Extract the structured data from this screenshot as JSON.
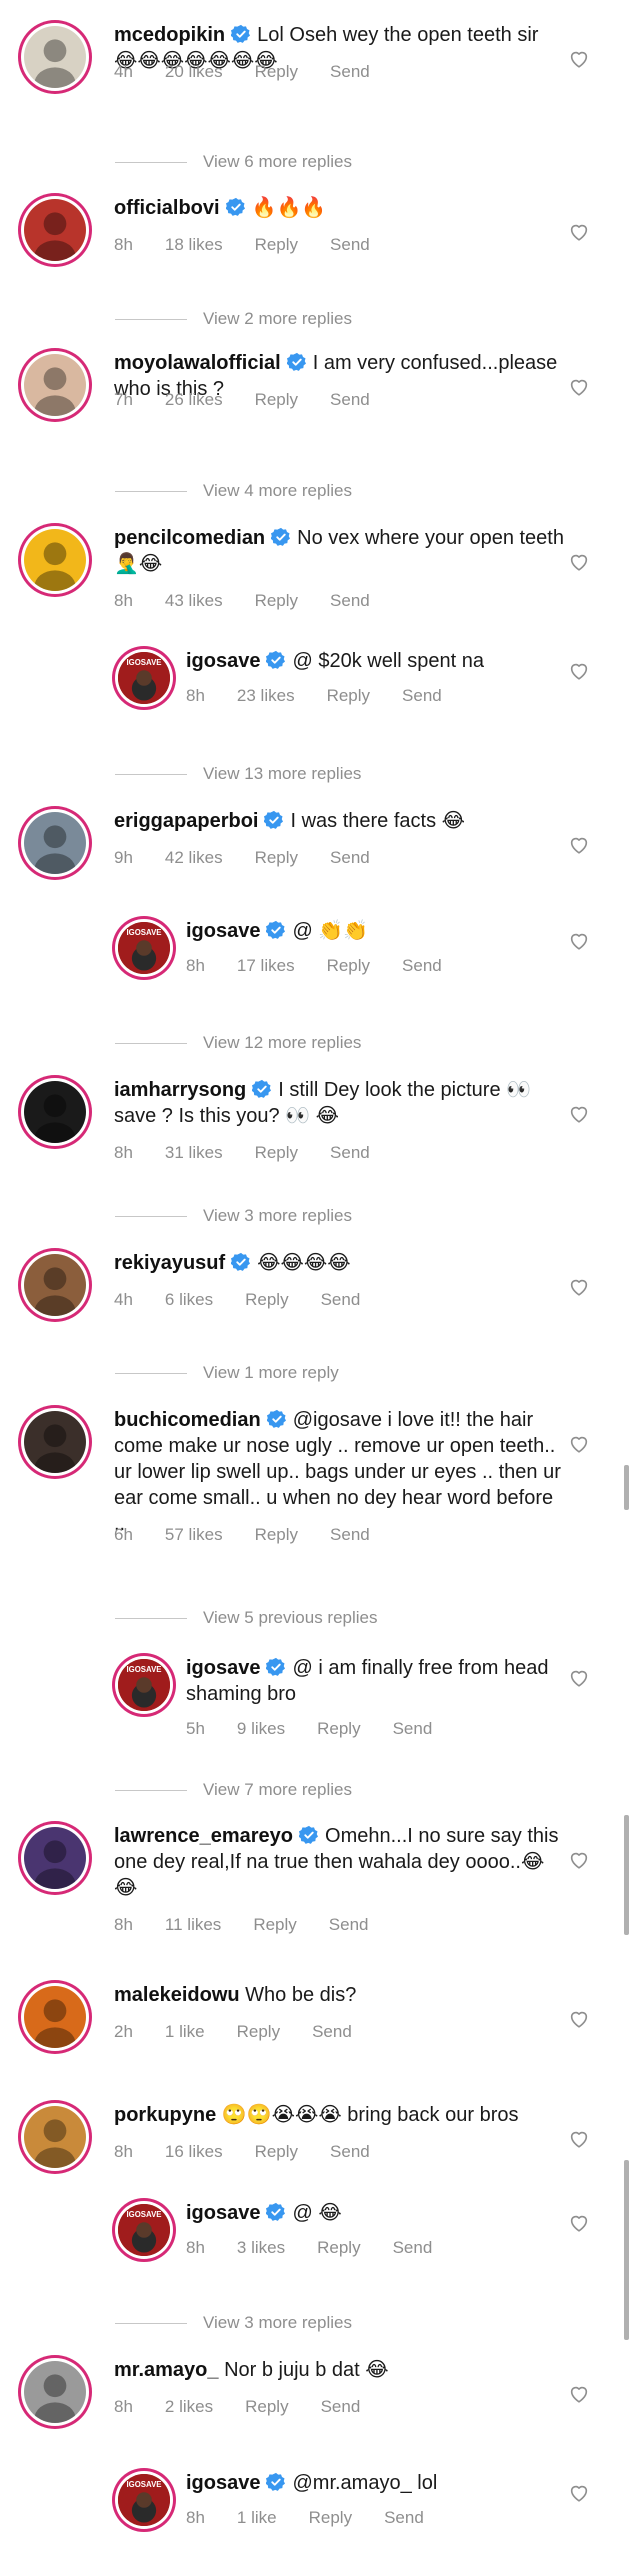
{
  "comments": [
    {
      "user": "mcedopikin",
      "verified": true,
      "text": "Lol Oseh wey the open teeth sir 😂😂😂😂😂😂😂",
      "time": "4h",
      "likes": "20 likes",
      "reply": "Reply",
      "send": "Send",
      "view_more": "View 6 more replies",
      "avatar_color": "#d8d2c4"
    },
    {
      "user": "officialbovi",
      "verified": true,
      "text": "🔥🔥🔥",
      "time": "8h",
      "likes": "18 likes",
      "reply": "Reply",
      "send": "Send",
      "view_more": "View 2 more replies",
      "avatar_color": "#b8342b"
    },
    {
      "user": "moyolawalofficial",
      "verified": true,
      "text": "I am very confused...please who is this ?",
      "time": "7h",
      "likes": "26 likes",
      "reply": "Reply",
      "send": "Send",
      "view_more": "View 4 more replies",
      "avatar_color": "#d9b8a0"
    },
    {
      "user": "pencilcomedian",
      "verified": true,
      "text": "No vex where your open teeth 🤦‍♂️😂",
      "time": "8h",
      "likes": "43 likes",
      "reply": "Reply",
      "send": "Send",
      "avatar_color": "#f2b71a",
      "reply_item": {
        "user": "igosave",
        "verified": true,
        "text": "@ $20k well spent na",
        "time": "8h",
        "likes": "23 likes",
        "reply": "Reply",
        "send": "Send"
      },
      "view_more": "View 13 more replies"
    },
    {
      "user": "eriggapaperboi",
      "verified": true,
      "text": "I was there facts 😂",
      "time": "9h",
      "likes": "42 likes",
      "reply": "Reply",
      "send": "Send",
      "avatar_color": "#7a8a99",
      "reply_item": {
        "user": "igosave",
        "verified": true,
        "text": "@ 👏👏",
        "time": "8h",
        "likes": "17 likes",
        "reply": "Reply",
        "send": "Send"
      },
      "view_more": "View 12 more replies"
    },
    {
      "user": "iamharrysong",
      "verified": true,
      "text": "I still Dey look the picture 👀 save ? Is this you? 👀 😂",
      "time": "8h",
      "likes": "31 likes",
      "reply": "Reply",
      "send": "Send",
      "view_more": "View 3 more replies",
      "avatar_color": "#1a1a1a"
    },
    {
      "user": "rekiyayusuf",
      "verified": true,
      "text": "😂😂😂😂",
      "time": "4h",
      "likes": "6 likes",
      "reply": "Reply",
      "send": "Send",
      "view_more": "View 1 more reply",
      "avatar_color": "#8b5e3c"
    },
    {
      "user": "buchicomedian",
      "verified": true,
      "text": "@igosave i love it!! the hair come make ur nose ugly .. remove ur open teeth.. ur lower lip swell up.. bags under ur eyes .. then ur ear come small.. u when no dey hear word before ..",
      "time": "6h",
      "likes": "57 likes",
      "reply": "Reply",
      "send": "Send",
      "prev": "View 5 previous replies",
      "avatar_color": "#3b2f2a",
      "reply_item": {
        "user": "igosave",
        "verified": true,
        "text": "@ i am finally free from head shaming bro",
        "time": "5h",
        "likes": "9 likes",
        "reply": "Reply",
        "send": "Send"
      },
      "view_more": "View 7 more replies"
    },
    {
      "user": "lawrence_emareyo",
      "verified": true,
      "text": "Omehn...I no sure say this one dey real,If na true then wahala dey oooo..😂😂",
      "time": "8h",
      "likes": "11 likes",
      "reply": "Reply",
      "send": "Send",
      "avatar_color": "#4a3570"
    },
    {
      "user": "malekeidowu",
      "verified": false,
      "text": "Who be dis?",
      "time": "2h",
      "likes": "1 like",
      "reply": "Reply",
      "send": "Send",
      "avatar_color": "#d86a1a"
    },
    {
      "user": "porkupyne",
      "verified": false,
      "text": "🙄🙄😭😭😭 bring back our bros",
      "time": "8h",
      "likes": "16 likes",
      "reply": "Reply",
      "send": "Send",
      "avatar_color": "#c98a3a",
      "reply_item": {
        "user": "igosave",
        "verified": true,
        "text": "@ 😂",
        "time": "8h",
        "likes": "3 likes",
        "reply": "Reply",
        "send": "Send"
      },
      "view_more": "View 3 more replies"
    },
    {
      "user": "mr.amayo_",
      "verified": false,
      "text": "Nor b juju b dat 😂",
      "time": "8h",
      "likes": "2 likes",
      "reply": "Reply",
      "send": "Send",
      "avatar_color": "#9a9a9a",
      "reply_item": {
        "user": "igosave",
        "verified": true,
        "text": "@mr.amayo_ lol",
        "time": "8h",
        "likes": "1 like",
        "reply": "Reply",
        "send": "Send"
      }
    }
  ],
  "igosave_badge": "IGOSAVE"
}
